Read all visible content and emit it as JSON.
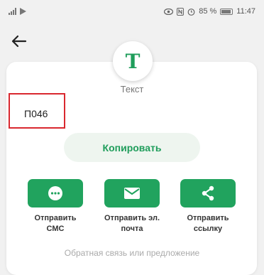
{
  "status_bar": {
    "battery_percent": "85 %",
    "time": "11:47"
  },
  "card": {
    "avatar_letter": "T",
    "type_label": "Текст",
    "content_text": "П046",
    "copy_label": "Копировать",
    "actions": [
      {
        "icon": "sms-icon",
        "label": "Отправить\nСМС"
      },
      {
        "icon": "email-icon",
        "label": "Отправить эл.\nпочта"
      },
      {
        "icon": "share-icon",
        "label": "Отправить\nссылку"
      }
    ],
    "feedback_label": "Обратная связь или предложение"
  },
  "colors": {
    "accent": "#1f9d5b",
    "button_green": "#21a35e",
    "highlight_red": "#d9282f"
  }
}
